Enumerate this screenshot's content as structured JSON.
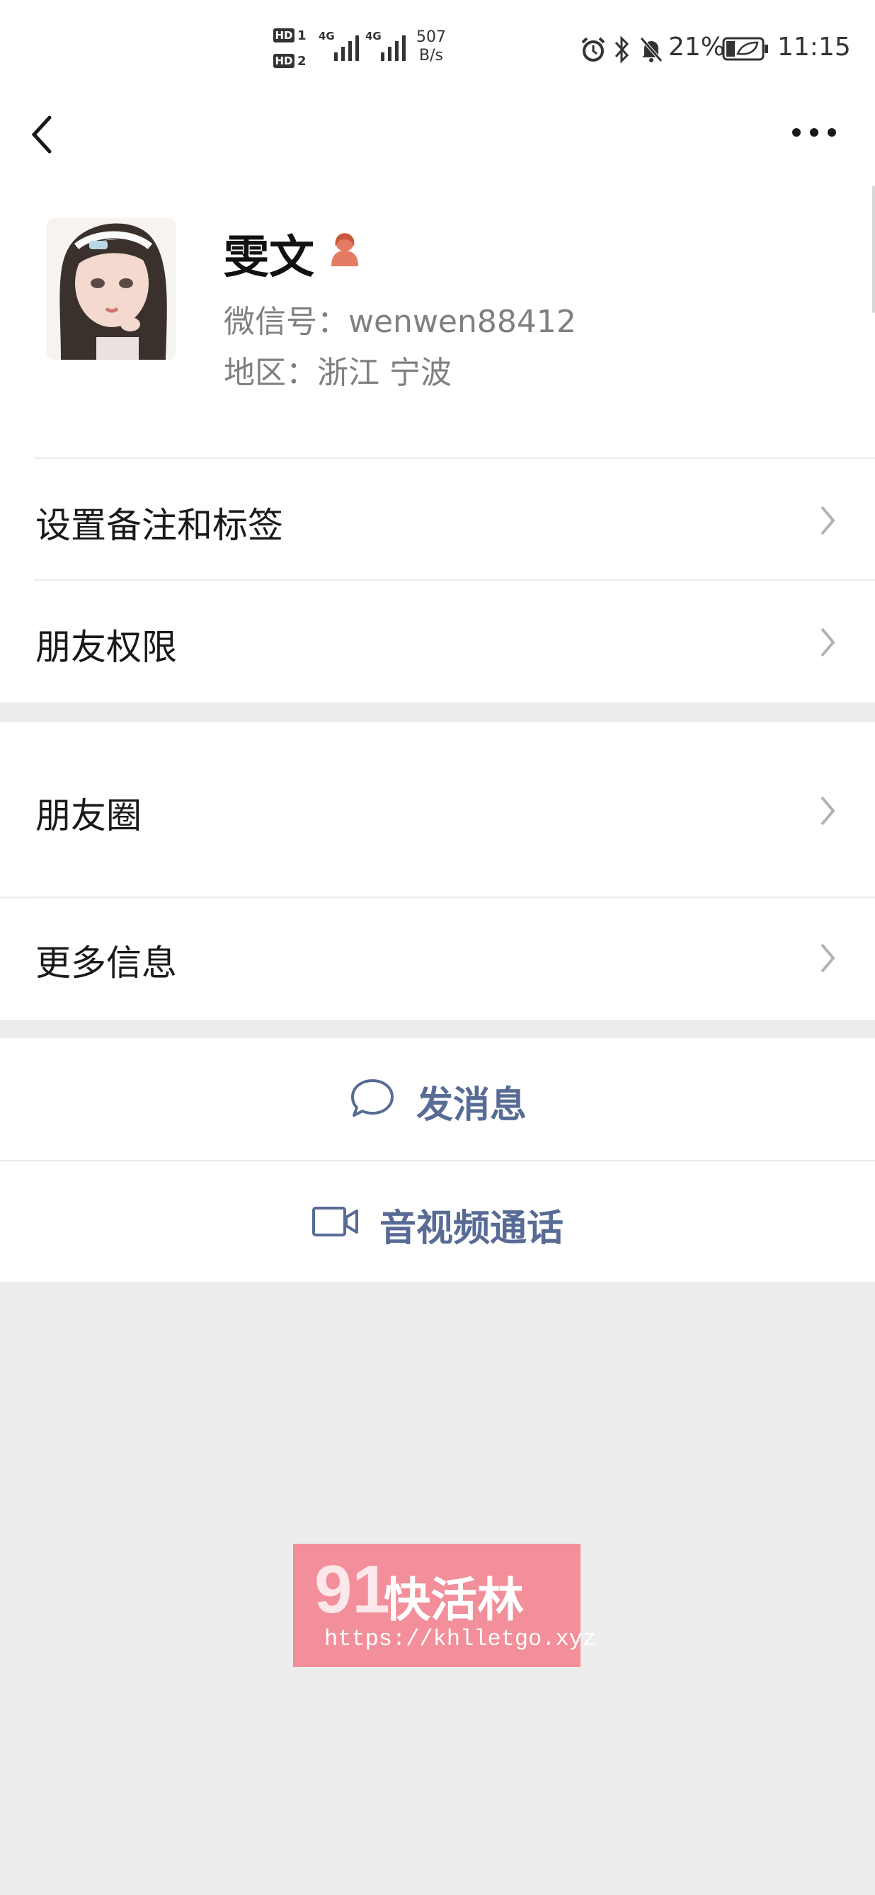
{
  "status_bar": {
    "hd1": "HD",
    "hd1_num": "1",
    "hd2": "HD",
    "hd2_num": "2",
    "sig1": "4G",
    "sig2": "4G",
    "speed_value": "507",
    "speed_unit": "B/s",
    "battery": "21%",
    "time": "11:15"
  },
  "profile": {
    "name": "雯文",
    "wechat_id": "微信号：wenwen88412",
    "region": "地区：浙江  宁波"
  },
  "menu": {
    "set_remark": "设置备注和标签",
    "friend_perm": "朋友权限",
    "moments": "朋友圈",
    "more_info": "更多信息"
  },
  "actions": {
    "send_message": "发消息",
    "video_call": "音视频通话"
  },
  "watermark": {
    "number": "91",
    "text": "快活林",
    "url": "https://khlletgo.xyz"
  },
  "colors": {
    "link_blue": "#576b95",
    "background": "#ededed",
    "watermark_pink": "#f28f9a",
    "gender_icon": "#e47b62"
  }
}
